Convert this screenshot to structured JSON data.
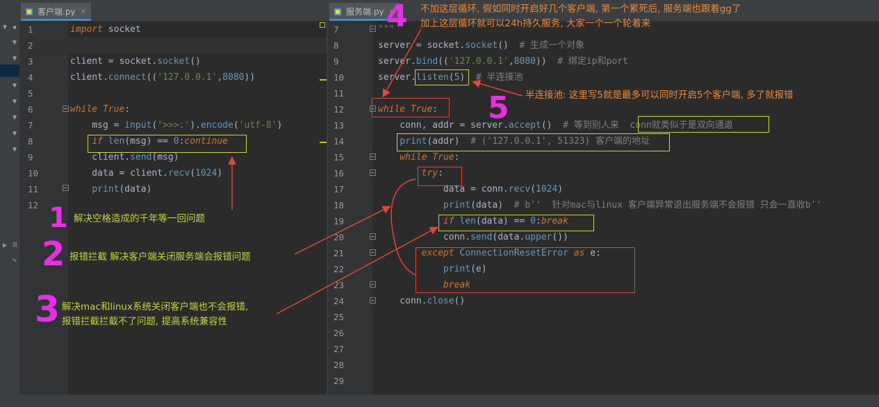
{
  "left_tab": {
    "name": "客户端.py"
  },
  "right_tab": {
    "name": "服务端.py"
  },
  "left_code": [
    {
      "n": "1",
      "t": "import socket"
    },
    {
      "n": "2",
      "t": ""
    },
    {
      "n": "3",
      "t": "client = socket.socket()"
    },
    {
      "n": "4",
      "t": "client.connect(('127.0.0.1',8080))"
    },
    {
      "n": "5",
      "t": ""
    },
    {
      "n": "6",
      "t": "while True:"
    },
    {
      "n": "7",
      "t": "    msg = input('>>>:').encode('utf-8')"
    },
    {
      "n": "8",
      "t": "    if len(msg) == 0:continue"
    },
    {
      "n": "9",
      "t": "    client.send(msg)"
    },
    {
      "n": "10",
      "t": "    data = client.recv(1024)"
    },
    {
      "n": "11",
      "t": "    print(data)"
    },
    {
      "n": "12",
      "t": ""
    }
  ],
  "right_code": [
    {
      "n": "7",
      "t": "\"\"\""
    },
    {
      "n": "8",
      "t": "server = socket.socket()  # 生成一个对象"
    },
    {
      "n": "9",
      "t": "server.bind(('127.0.0.1',8080))  # 绑定ip和port"
    },
    {
      "n": "10",
      "t": "server.listen(5)  # 半连接池"
    },
    {
      "n": "11",
      "t": ""
    },
    {
      "n": "12",
      "t": "while True:"
    },
    {
      "n": "13",
      "t": "    conn, addr = server.accept()  # 等到别人来  conn就类似于是双向通道"
    },
    {
      "n": "14",
      "t": "    print(addr)  # ('127.0.0.1', 51323) 客户端的地址"
    },
    {
      "n": "15",
      "t": "    while True:"
    },
    {
      "n": "16",
      "t": "        try:"
    },
    {
      "n": "17",
      "t": "            data = conn.recv(1024)"
    },
    {
      "n": "18",
      "t": "            print(data)  # b''  针对mac与linux 客户端异常退出服务端不会报错 只会一直收b''"
    },
    {
      "n": "19",
      "t": "            if len(data) == 0:break"
    },
    {
      "n": "20",
      "t": "            conn.send(data.upper())"
    },
    {
      "n": "21",
      "t": "        except ConnectionResetError as e:"
    },
    {
      "n": "22",
      "t": "            print(e)"
    },
    {
      "n": "23",
      "t": "            break"
    },
    {
      "n": "24",
      "t": "    conn.close()"
    },
    {
      "n": "25",
      "t": ""
    },
    {
      "n": "26",
      "t": ""
    },
    {
      "n": "27",
      "t": ""
    },
    {
      "n": "28",
      "t": ""
    },
    {
      "n": "29",
      "t": ""
    }
  ],
  "annotations": {
    "n1": "1",
    "a1": "解决空格造成的千年等一回问题",
    "n2": "2",
    "a2": "报错拦截 解决客户端关闭服务端会报错问题",
    "n3": "3",
    "a3_l1": "解决mac和linux系统关闭客户端也不会报错,",
    "a3_l2": "报错拦截拦截不了问题, 提高系统兼容性",
    "n4": "4",
    "a4_l1": "不加这层循环, 假如同时开启好几个客户端, 第一个累死后, 服务端也跟着gg了",
    "a4_l2": "加上这层循环就可以24h持久服务, 大家一个一个轮着来",
    "n5": "5",
    "a5": "半连接池: 这里写5就是最多可以同时开启5个客户端, 多了就报错"
  },
  "colors": {
    "annotation_yellow": "#c7d23a",
    "annotation_orange": "#ec8a3c",
    "annotation_red": "#e2463a",
    "annotation_magenta": "#e331e3"
  }
}
